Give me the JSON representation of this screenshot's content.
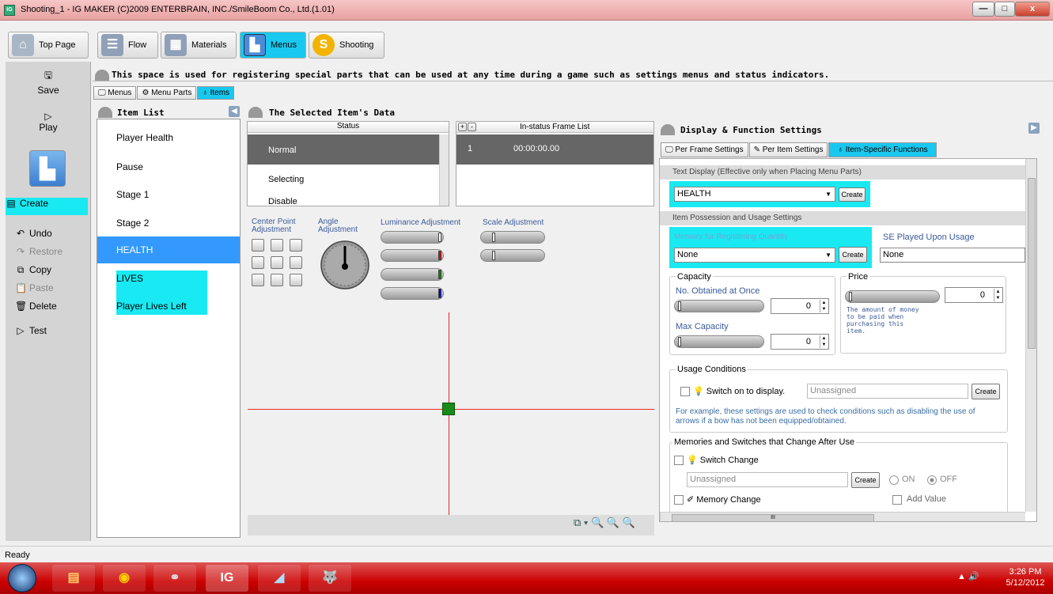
{
  "window": {
    "title": "Shooting_1 - IG MAKER (C)2009 ENTERBRAIN, INC./SmileBoom Co., Ltd.(1.01)",
    "app_icon": "IG",
    "min": "—",
    "max": "□",
    "close": "x"
  },
  "toptabs": [
    {
      "label": "Top Page",
      "icon": "home-icon"
    },
    {
      "label": "Flow",
      "icon": "flow-icon"
    },
    {
      "label": "Materials",
      "icon": "materials-icon"
    },
    {
      "label": "Menus",
      "icon": "menus-icon"
    },
    {
      "label": "Shooting",
      "icon": "shooting-icon",
      "glyph": "S"
    }
  ],
  "leftbar": {
    "save": "Save",
    "play": "Play",
    "create": "Create",
    "undo": "Undo",
    "restore": "Restore",
    "copy": "Copy",
    "paste": "Paste",
    "delete": "Delete",
    "test": "Test"
  },
  "info": "This space is used for registering special parts that can be used at any time during a game such as settings menus and status indicators.",
  "subtabs": [
    "Menus",
    "Menu Parts",
    "Items"
  ],
  "item_list": {
    "title": "Item List",
    "items": [
      "Player Health",
      "Pause",
      "Stage 1",
      "Stage 2",
      "HEALTH",
      "LIVES",
      "Player Lives Left"
    ]
  },
  "selected": {
    "title": "The Selected Item's Data",
    "status_header": "Status",
    "statuses": [
      "Normal",
      "Selecting",
      "Disable"
    ],
    "frame_header": "In-status Frame List",
    "frame_btns": [
      "+",
      "-"
    ],
    "frames": [
      {
        "num": "1",
        "time": "00:00:00.00"
      }
    ],
    "center_label": "Center Point Adjustment",
    "angle_label": "Angle Adjustment",
    "lum_label": "Luminance Adjustment",
    "scale_label": "Scale Adjustment",
    "zoom_icons": "⧉ ▾ 🔍 🔍 🔍",
    "colors": {
      "red": "#dd0000",
      "green": "#008800",
      "blue": "#0000dd"
    }
  },
  "display": {
    "title": "Display & Function Settings",
    "tabs": [
      "Per Frame Settings",
      "Per Item Settings",
      "Item-Specific Functions"
    ],
    "text_display_label": "Text Display (Effective only when Placing Menu Parts)",
    "text_value": "HEALTH",
    "create": "Create",
    "possession_label": "Item Possession and Usage Settings",
    "memory_label": "Memory for Registering Quantity",
    "memory_value": "None",
    "se_label": "SE Played Upon Usage",
    "se_value": "None",
    "capacity": "Capacity",
    "obtained": "No. Obtained at Once",
    "obtained_val": "0",
    "max_cap": "Max Capacity",
    "max_val": "0",
    "price": "Price",
    "price_val": "0",
    "price_note": "The amount of money to be paid when purchasing this item.",
    "usage": "Usage Conditions",
    "switch_display": "Switch on to display.",
    "unassigned": "Unassigned",
    "usage_note": "For example, these settings are used to check conditions such as disabling the use of arrows if a bow has not been equipped/obtained.",
    "mem_switch": "Memories and Switches that Change After Use",
    "switch_change": "Switch Change",
    "on": "ON",
    "off": "OFF",
    "memory_change": "Memory Change",
    "add_value": "Add Value",
    "scroll_mark": "III"
  },
  "status": "Ready",
  "clock": {
    "time": "3:26 PM",
    "date": "5/12/2012"
  }
}
